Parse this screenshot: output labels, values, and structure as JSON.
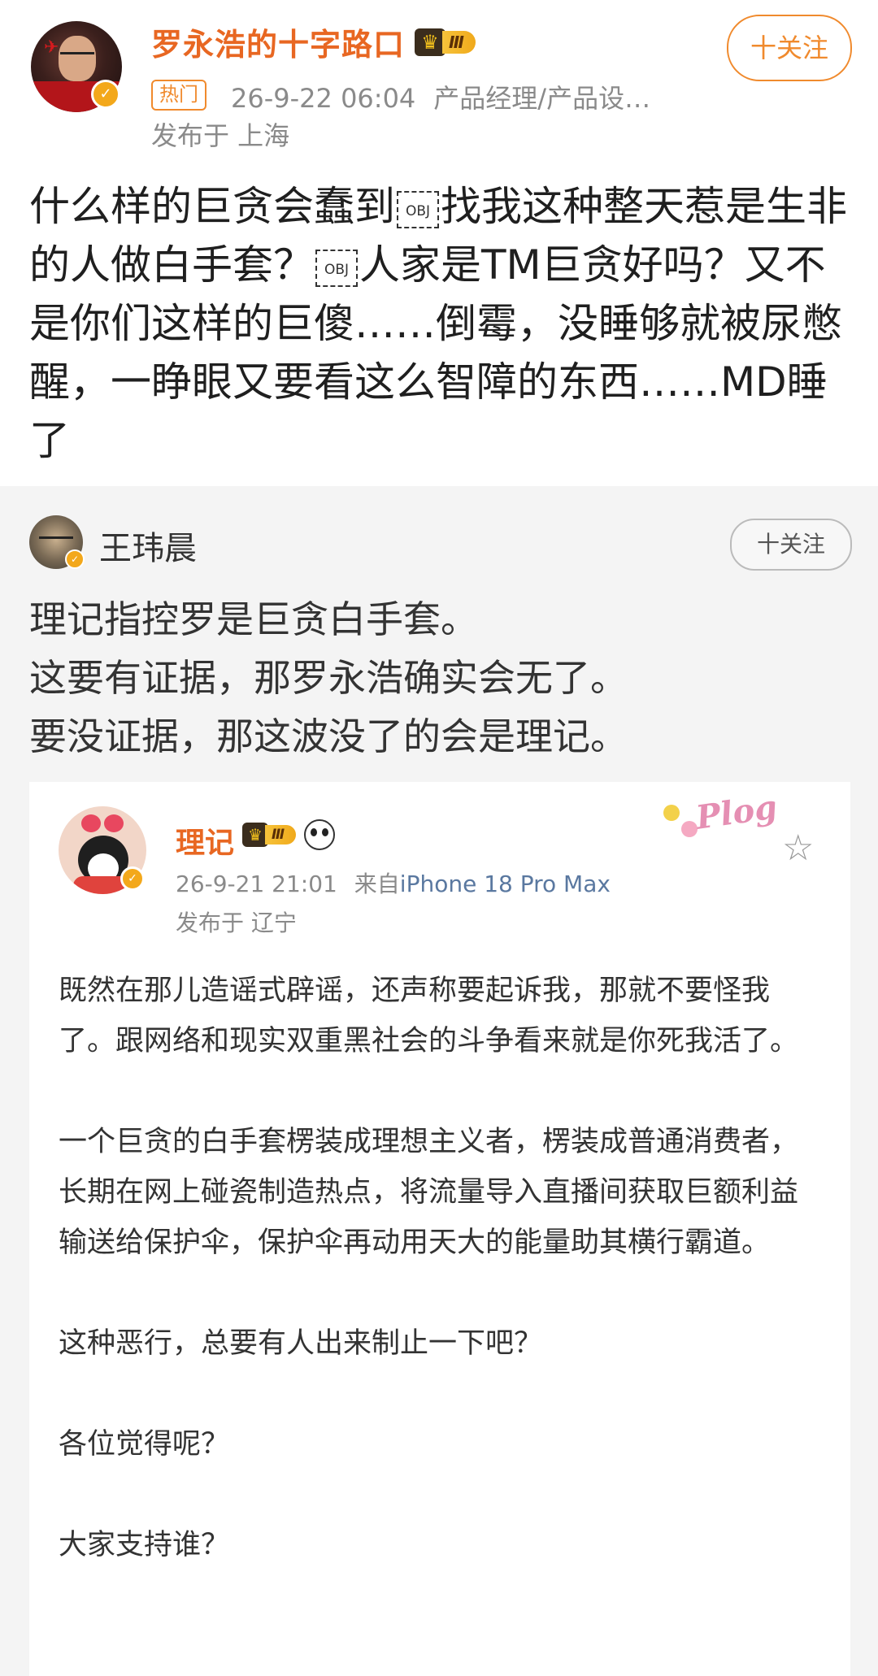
{
  "main_post": {
    "author": "罗永浩的十字路口",
    "level_badge": "Ⅲ",
    "follow_label": "十关注",
    "hot_tag": "热门",
    "time": "26-9-22 06:04",
    "category": "产品经理/产品设…",
    "location": "发布于 上海",
    "body": {
      "p1": "什么样的巨贪会蠢到",
      "obj1": "OBJ",
      "p2": "找我这种整天惹是生非的人做白手套？",
      "obj2": "OBJ",
      "p3": "人家是TM巨贪好吗？又不是你们这样的巨傻……倒霉，没睡够就被尿憋醒，一睁眼又要看这么智障的东西……MD睡了"
    }
  },
  "repost": {
    "author": "王玮晨",
    "follow_label": "十关注",
    "lines": [
      "理记指控罗是巨贪白手套。",
      "这要有证据，那罗永浩确实会无了。",
      "要没证据，那这波没了的会是理记。"
    ]
  },
  "quoted_post": {
    "author": "理记",
    "level_badge": "Ⅲ",
    "time": "26-9-21 21:01",
    "source_prefix": "来自",
    "device": "iPhone 18 Pro Max",
    "location": "发布于 辽宁",
    "sticker_text": "Plog",
    "paragraphs": [
      "既然在那儿造谣式辟谣，还声称要起诉我，那就不要怪我了。跟网络和现实双重黑社会的斗争看来就是你死我活了。",
      "一个巨贪的白手套楞装成理想主义者，楞装成普通消费者，长期在网上碰瓷制造热点，将流量导入直播间获取巨额利益输送给保护伞，保护伞再动用天大的能量助其横行霸道。",
      "这种恶行，总要有人出来制止一下吧？",
      "各位觉得呢？",
      "大家支持谁？"
    ]
  },
  "colors": {
    "accent_orange": "#e86722",
    "follow_orange": "#f08a2d",
    "meta_gray": "#8a8a8a",
    "background": "#f4f4f4"
  }
}
